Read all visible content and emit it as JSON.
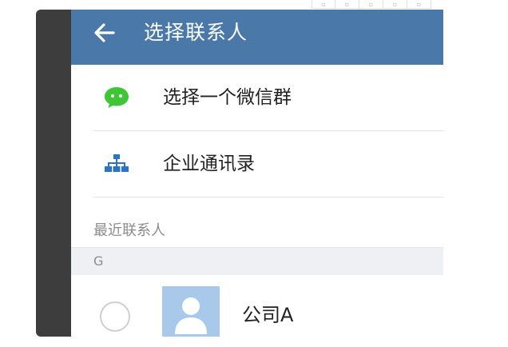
{
  "header": {
    "title": "选择联系人",
    "back_icon": "arrow-left-icon"
  },
  "menu": {
    "items": [
      {
        "label": "选择一个微信群",
        "icon": "wechat-chat-icon"
      },
      {
        "label": "企业通讯录",
        "icon": "org-chart-icon"
      }
    ]
  },
  "recent": {
    "header": "最近联系人"
  },
  "index_letter": "G",
  "contacts": [
    {
      "name": "公司A",
      "avatar": "default-avatar-icon",
      "selected": false
    }
  ],
  "colors": {
    "title_bar": "#4a78a8",
    "wechat_green": "#3ec636",
    "org_blue": "#2b74c4",
    "avatar_bg": "#a9c9ea"
  }
}
